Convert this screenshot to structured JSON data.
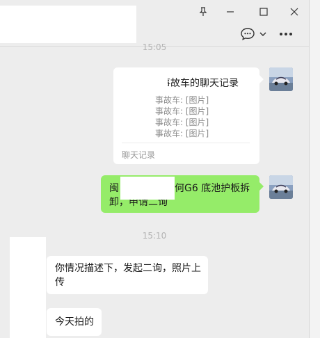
{
  "window": {
    "pin_icon": "pin-icon",
    "minimize_icon": "minimize-icon",
    "maximize_icon": "maximize-icon",
    "close_icon": "close-icon"
  },
  "toolbar": {
    "chat_icon": "chat-bubble-icon",
    "dropdown_icon": "chevron-down-icon",
    "more_icon": "more-icon"
  },
  "messages": {
    "time_top": "15:05",
    "forward": {
      "title": "事故车的聊天记录",
      "lines": [
        "事故车: [图片]",
        "事故车: [图片]",
        "事故车: [图片]",
        "事故车: [图片]"
      ],
      "footer": "聊天记录"
    },
    "sent_text_line1_a": "闽",
    "sent_text_line1_b": "何G6 底池护板拆",
    "sent_text_line2": "卸，申请二询",
    "time_mid": "15:10",
    "received_1_line1": "你情况描述下，发起二询，照片上",
    "received_1_line2": "传",
    "received_2": "今天拍的"
  },
  "colors": {
    "chat_bg": "#ededed",
    "sent_bubble": "#95ec69",
    "received_bubble": "#ffffff",
    "meta_text": "#b2b2b2"
  }
}
